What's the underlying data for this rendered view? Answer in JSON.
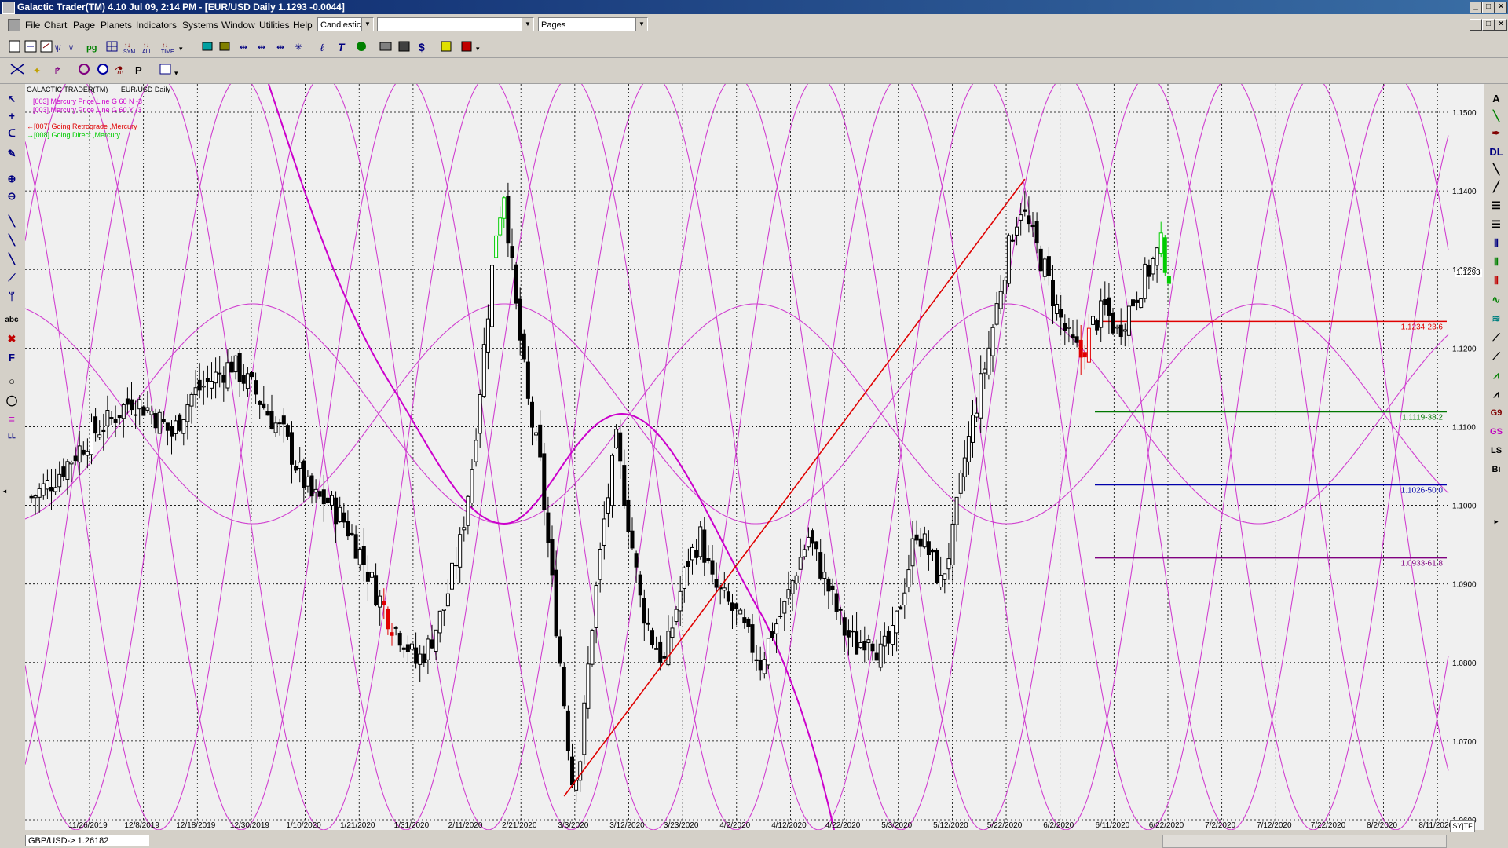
{
  "window": {
    "title": "Galactic Trader(TM) 4.10 Jul 09,  2:14 PM - [EUR/USD Daily  1.1293  -0.0044]"
  },
  "menubar": {
    "items": [
      "File",
      "Chart",
      "Page",
      "Planets",
      "Indicators",
      "Systems",
      "Window",
      "Utilities",
      "Help"
    ],
    "chart_type": "Candlestick",
    "combo_blank": "",
    "pages": "Pages"
  },
  "chart": {
    "header_left": "GALACTIC TRADER(TM)",
    "header_right": "EUR/USD Daily",
    "legend": [
      {
        "text": "[003] Mercury Price Line G 60 N -3",
        "color": "#cc00cc"
      },
      {
        "text": "[003] Mercury Price Line G 60 Y -3",
        "color": "#cc00cc"
      },
      {
        "text": "[007] Going Retrograde ,Mercury",
        "color": "#e00000"
      },
      {
        "text": "[008] Going Direct ,Mercury",
        "color": "#00cc00"
      }
    ],
    "current_price": "1.1293",
    "fib_levels": [
      {
        "label": "1.1234-23.6",
        "value": 1.1234,
        "color": "#e00000"
      },
      {
        "label": "1.1119-38.2",
        "value": 1.1119,
        "color": "#007700"
      },
      {
        "label": "1.1026-50.0",
        "value": 1.1026,
        "color": "#0000aa"
      },
      {
        "label": "1.0933-61.8",
        "value": 1.0933,
        "color": "#800080"
      }
    ]
  },
  "chart_data": {
    "type": "candlestick",
    "y_ticks": [
      "1.1500",
      "1.1400",
      "1.1300",
      "1.1200",
      "1.1100",
      "1.1000",
      "1.0900",
      "1.0800",
      "1.0700",
      "1.0600"
    ],
    "ylim": [
      1.06,
      1.153
    ],
    "x_ticks": [
      "11/26/2019",
      "12/8/2019",
      "12/18/2019",
      "12/30/2019",
      "1/10/2020",
      "1/21/2020",
      "1/31/2020",
      "2/11/2020",
      "2/21/2020",
      "3/3/2020",
      "3/12/2020",
      "3/23/2020",
      "4/2/2020",
      "4/12/2020",
      "4/22/2020",
      "5/3/2020",
      "5/12/2020",
      "5/22/2020",
      "6/2/2020",
      "6/11/2020",
      "6/22/2020",
      "7/2/2020",
      "7/12/2020",
      "7/22/2020",
      "8/2/2020",
      "8/11/2020"
    ],
    "close_path": [
      [
        0,
        1.101
      ],
      [
        5,
        1.103
      ],
      [
        10,
        1.106
      ],
      [
        15,
        1.109
      ],
      [
        20,
        1.111
      ],
      [
        25,
        1.1135
      ],
      [
        30,
        1.112
      ],
      [
        35,
        1.109
      ],
      [
        40,
        1.114
      ],
      [
        45,
        1.116
      ],
      [
        50,
        1.118
      ],
      [
        55,
        1.115
      ],
      [
        60,
        1.111
      ],
      [
        63,
        1.109
      ],
      [
        67,
        1.104
      ],
      [
        70,
        1.101
      ],
      [
        74,
        1.1005
      ],
      [
        78,
        1.098
      ],
      [
        82,
        1.094
      ],
      [
        86,
        1.089
      ],
      [
        90,
        1.085
      ],
      [
        93,
        1.083
      ],
      [
        96,
        1.08
      ],
      [
        99,
        1.082
      ],
      [
        103,
        1.087
      ],
      [
        107,
        1.095
      ],
      [
        110,
        1.105
      ],
      [
        113,
        1.12
      ],
      [
        116,
        1.135
      ],
      [
        118,
        1.14
      ],
      [
        121,
        1.125
      ],
      [
        124,
        1.113
      ],
      [
        127,
        1.105
      ],
      [
        130,
        1.09
      ],
      [
        133,
        1.075
      ],
      [
        135,
        1.065
      ],
      [
        137,
        1.068
      ],
      [
        140,
        1.085
      ],
      [
        143,
        1.098
      ],
      [
        146,
        1.108
      ],
      [
        149,
        1.098
      ],
      [
        152,
        1.088
      ],
      [
        155,
        1.083
      ],
      [
        158,
        1.08
      ],
      [
        161,
        1.087
      ],
      [
        164,
        1.093
      ],
      [
        167,
        1.096
      ],
      [
        170,
        1.09
      ],
      [
        173,
        1.088
      ],
      [
        176,
        1.086
      ],
      [
        179,
        1.083
      ],
      [
        182,
        1.08
      ],
      [
        185,
        1.084
      ],
      [
        188,
        1.087
      ],
      [
        191,
        1.092
      ],
      [
        194,
        1.096
      ],
      [
        197,
        1.092
      ],
      [
        200,
        1.088
      ],
      [
        203,
        1.084
      ],
      [
        206,
        1.082
      ],
      [
        209,
        1.084
      ],
      [
        212,
        1.081
      ],
      [
        215,
        1.083
      ],
      [
        218,
        1.09
      ],
      [
        221,
        1.097
      ],
      [
        224,
        1.094
      ],
      [
        227,
        1.09
      ],
      [
        230,
        1.096
      ],
      [
        233,
        1.106
      ],
      [
        236,
        1.113
      ],
      [
        239,
        1.12
      ],
      [
        242,
        1.128
      ],
      [
        245,
        1.135
      ],
      [
        247,
        1.138
      ],
      [
        250,
        1.134
      ],
      [
        253,
        1.13
      ],
      [
        256,
        1.125
      ],
      [
        259,
        1.121
      ],
      [
        262,
        1.119
      ],
      [
        265,
        1.123
      ],
      [
        268,
        1.125
      ],
      [
        271,
        1.122
      ],
      [
        274,
        1.125
      ],
      [
        277,
        1.128
      ],
      [
        280,
        1.131
      ],
      [
        282,
        1.133
      ],
      [
        284,
        1.1293
      ]
    ],
    "x_range": [
      0,
      330
    ],
    "series": [
      {
        "name": "[003] Mercury Price Line G 60 N -3"
      },
      {
        "name": "[003] Mercury Price Line G 60 Y -3"
      }
    ],
    "trendline": {
      "from": [
        133,
        1.063
      ],
      "to": [
        248,
        1.1415
      ]
    }
  },
  "statusbar": {
    "text": "GBP/USD-> 1.26182",
    "corner": "SY|TF"
  },
  "icons": {
    "left": [
      "arrow-cursor-icon",
      "crosshair-icon",
      "magnet-icon",
      "pencil-icon",
      "zoom-in-icon",
      "zoom-out-icon",
      "trendline-icon",
      "ray-icon",
      "parallel-icon",
      "fan-icon",
      "pitchfork-icon",
      "text-icon",
      "delete-icon",
      "fib-icon",
      "circle-icon",
      "ellipse-icon",
      "bars-icon",
      "cycle-icon"
    ],
    "right": [
      "A",
      "line",
      "pen",
      "DL",
      "arrow",
      "arrow2",
      "lines",
      "lines2",
      "cycles",
      "cycles2",
      "cycles3",
      "curve",
      "curve2",
      "arrow3",
      "fan",
      "fan2",
      "gann",
      "G9",
      "GS",
      "LS",
      "Bi"
    ]
  }
}
